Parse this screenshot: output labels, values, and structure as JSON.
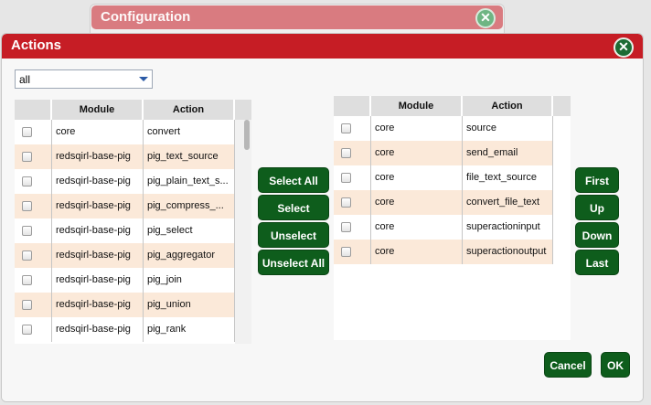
{
  "background_dialog": {
    "title": "Configuration",
    "close_glyph": "✕"
  },
  "dialog": {
    "title": "Actions",
    "close_glyph": "✕"
  },
  "filter": {
    "value": "all"
  },
  "available": {
    "headers": {
      "module": "Module",
      "action": "Action"
    },
    "rows": [
      {
        "module": "core",
        "action": "convert"
      },
      {
        "module": "redsqirl-base-pig",
        "action": "pig_text_source"
      },
      {
        "module": "redsqirl-base-pig",
        "action": "pig_plain_text_s..."
      },
      {
        "module": "redsqirl-base-pig",
        "action": "pig_compress_..."
      },
      {
        "module": "redsqirl-base-pig",
        "action": "pig_select"
      },
      {
        "module": "redsqirl-base-pig",
        "action": "pig_aggregator"
      },
      {
        "module": "redsqirl-base-pig",
        "action": "pig_join"
      },
      {
        "module": "redsqirl-base-pig",
        "action": "pig_union"
      },
      {
        "module": "redsqirl-base-pig",
        "action": "pig_rank"
      }
    ]
  },
  "selected": {
    "headers": {
      "module": "Module",
      "action": "Action"
    },
    "rows": [
      {
        "module": "core",
        "action": "source"
      },
      {
        "module": "core",
        "action": "send_email"
      },
      {
        "module": "core",
        "action": "file_text_source"
      },
      {
        "module": "core",
        "action": "convert_file_text"
      },
      {
        "module": "core",
        "action": "superactioninput"
      },
      {
        "module": "core",
        "action": "superactionoutput"
      }
    ]
  },
  "transfer_buttons": {
    "select_all": "Select All",
    "select": "Select",
    "unselect": "Unselect",
    "unselect_all": "Unselect All"
  },
  "order_buttons": {
    "first": "First",
    "up": "Up",
    "down": "Down",
    "last": "Last"
  },
  "footer": {
    "cancel": "Cancel",
    "ok": "OK"
  }
}
